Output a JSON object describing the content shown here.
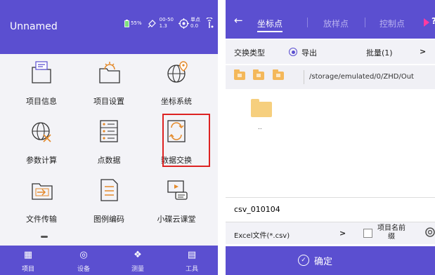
{
  "left": {
    "title": "Unnamed",
    "status": {
      "battery": "55%",
      "sats_top": "00-50",
      "sats_bottom": "1.3",
      "solution_top": "单点",
      "solution_bottom": "0.0"
    },
    "tiles": [
      {
        "label": "项目信息",
        "icon": "folder-doc-icon"
      },
      {
        "label": "项目设置",
        "icon": "folder-gear-icon"
      },
      {
        "label": "坐标系统",
        "icon": "globe-pin-icon"
      },
      {
        "label": "参数计算",
        "icon": "globe-calc-icon"
      },
      {
        "label": "点数据",
        "icon": "point-data-icon"
      },
      {
        "label": "数据交换",
        "icon": "data-exchange-icon"
      },
      {
        "label": "文件传输",
        "icon": "file-transfer-icon"
      },
      {
        "label": "图例编码",
        "icon": "legend-code-icon"
      },
      {
        "label": "小碟云课堂",
        "icon": "classroom-icon"
      }
    ],
    "nav": [
      {
        "label": "项目",
        "icon": "project-icon"
      },
      {
        "label": "设备",
        "icon": "device-icon"
      },
      {
        "label": "测量",
        "icon": "measure-icon"
      },
      {
        "label": "工具",
        "icon": "tools-icon"
      }
    ]
  },
  "right": {
    "back_glyph": "←",
    "tabs": [
      "坐标点",
      "放样点",
      "控制点"
    ],
    "more": "?",
    "exchange_type_label": "交换类型",
    "export_label": "导出",
    "batch_label": "批量(1)",
    "chevron": ">",
    "path": "/storage/emulated/0/ZHD/Out",
    "parent_folder": "..",
    "file_name": "csv_010104",
    "file_type": "Excel文件(*.csv)",
    "prefix_label_1": "项目名前",
    "prefix_label_2": "缀",
    "confirm_label": "确定",
    "colors": {
      "accent": "#5b4fd0",
      "highlight": "#d22222",
      "folder": "#f6cf7e"
    }
  }
}
